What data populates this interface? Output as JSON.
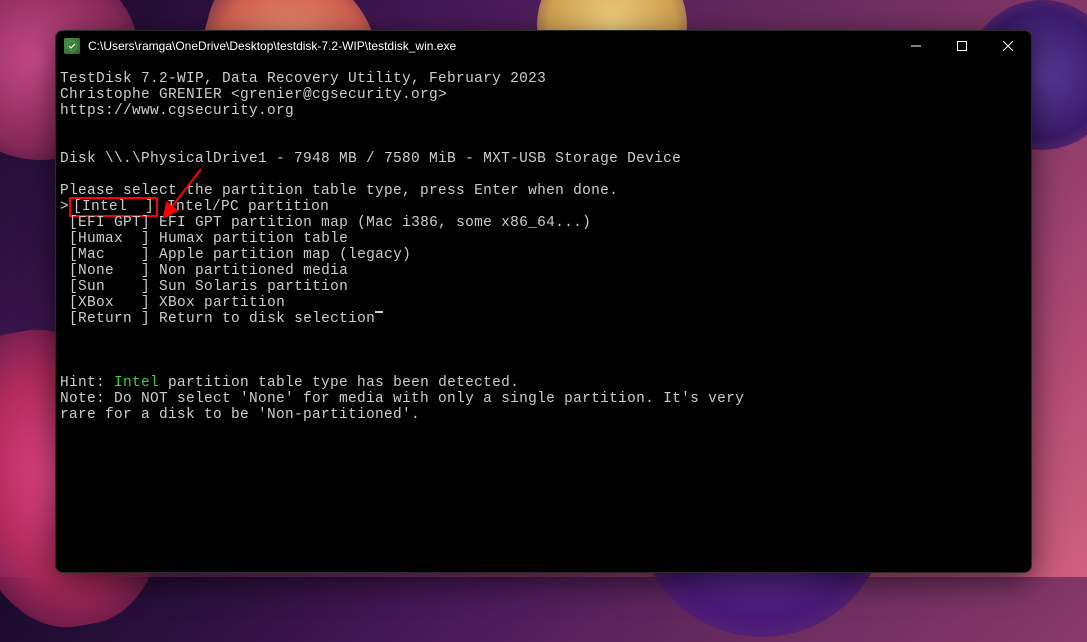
{
  "window": {
    "title": "C:\\Users\\ramga\\OneDrive\\Desktop\\testdisk-7.2-WIP\\testdisk_win.exe"
  },
  "header": {
    "line1": "TestDisk 7.2-WIP, Data Recovery Utility, February 2023",
    "line2": "Christophe GRENIER <grenier@cgsecurity.org>",
    "line3": "https://www.cgsecurity.org"
  },
  "disk_info": "Disk \\\\.\\PhysicalDrive1 - 7948 MB / 7580 MiB - MXT-USB Storage Device",
  "prompt": "Please select the partition table type, press Enter when done.",
  "menu_items": [
    {
      "prefix": ">",
      "option": "[Intel  ]",
      "desc": "Intel/PC partition",
      "selected": true
    },
    {
      "prefix": " ",
      "option": "[EFI GPT]",
      "desc": "EFI GPT partition map (Mac i386, some x86_64...)",
      "selected": false
    },
    {
      "prefix": " ",
      "option": "[Humax  ]",
      "desc": "Humax partition table",
      "selected": false
    },
    {
      "prefix": " ",
      "option": "[Mac    ]",
      "desc": "Apple partition map (legacy)",
      "selected": false
    },
    {
      "prefix": " ",
      "option": "[None   ]",
      "desc": "Non partitioned media",
      "selected": false
    },
    {
      "prefix": " ",
      "option": "[Sun    ]",
      "desc": "Sun Solaris partition",
      "selected": false
    },
    {
      "prefix": " ",
      "option": "[XBox   ]",
      "desc": "XBox partition",
      "selected": false
    },
    {
      "prefix": " ",
      "option": "[Return ]",
      "desc": "Return to disk selection",
      "selected": false
    }
  ],
  "hint": {
    "prefix": "Hint: ",
    "highlighted": "Intel",
    "suffix": " partition table type has been detected."
  },
  "note": {
    "line1": "Note: Do NOT select 'None' for media with only a single partition. It's very",
    "line2": "rare for a disk to be 'Non-partitioned'."
  }
}
